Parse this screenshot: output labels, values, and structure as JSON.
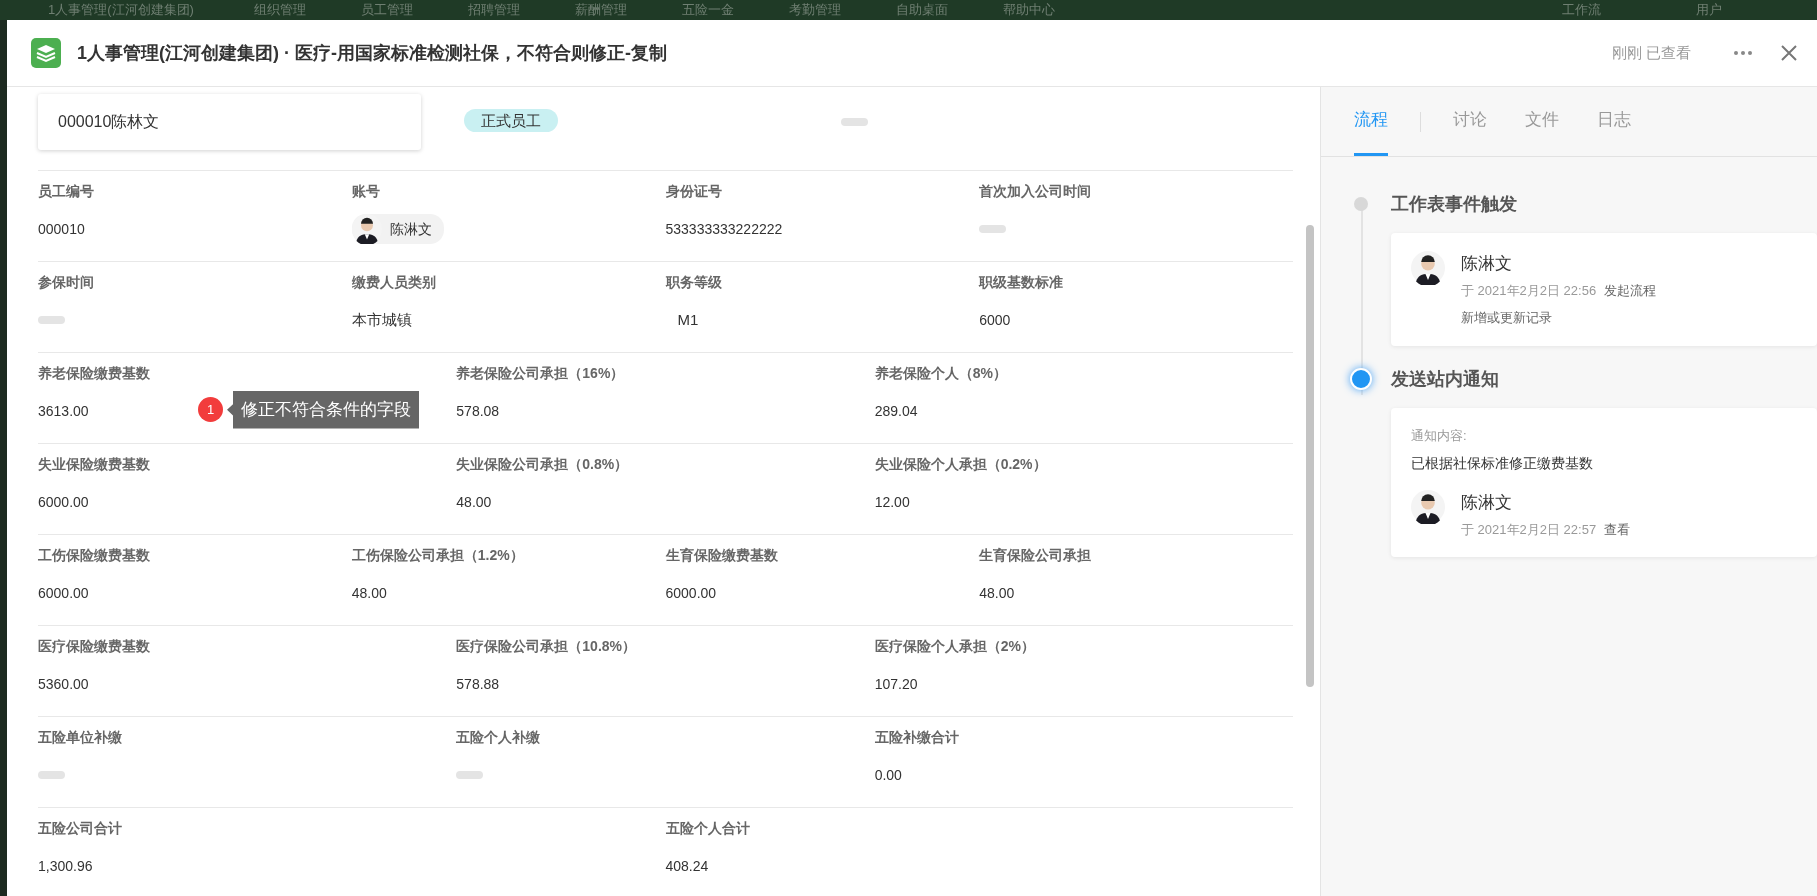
{
  "background_nav": {
    "app": "1人事管理(江河创建集团)",
    "items": [
      "组织管理",
      "员工管理",
      "招聘管理",
      "薪酬管理",
      "五险一金",
      "考勤管理",
      "自助桌面",
      "帮助中心"
    ],
    "right": [
      "工作流",
      "用户"
    ]
  },
  "header": {
    "title": "1人事管理(江河创建集团) · 医疗-用国家标准检测社保，不符合则修正-复制",
    "status": "刚刚 已查看"
  },
  "record": {
    "title": "000010陈林文",
    "items": [
      {
        "kind": "tag",
        "text": "正式员工"
      },
      {
        "kind": "empty"
      }
    ]
  },
  "rows": [
    [
      {
        "label": "员工编号",
        "kind": "text",
        "value": "000010"
      },
      {
        "label": "账号",
        "kind": "user",
        "value": "陈淋文"
      },
      {
        "label": "身份证号",
        "kind": "text",
        "value": "533333333222222"
      },
      {
        "label": "首次加入公司时间",
        "kind": "empty"
      }
    ],
    [
      {
        "label": "参保时间",
        "kind": "empty"
      },
      {
        "label": "缴费人员类别",
        "kind": "option",
        "value": "本市城镇"
      },
      {
        "label": "职务等级",
        "kind": "option",
        "value": "M1"
      },
      {
        "label": "职级基数标准",
        "kind": "text",
        "value": "6000"
      }
    ],
    [
      {
        "label": "养老保险缴费基数",
        "kind": "text",
        "value": "3613.00",
        "annotation": {
          "badge": "1",
          "text": "修正不符合条件的字段"
        }
      },
      {
        "label": "养老保险公司承担（16%）",
        "kind": "text",
        "value": "578.08"
      },
      {
        "label": "养老保险个人（8%）",
        "kind": "text",
        "value": "289.04"
      }
    ],
    [
      {
        "label": "失业保险缴费基数",
        "kind": "text",
        "value": "6000.00"
      },
      {
        "label": "失业保险公司承担（0.8%）",
        "kind": "text",
        "value": "48.00"
      },
      {
        "label": "失业保险个人承担（0.2%）",
        "kind": "text",
        "value": "12.00"
      }
    ],
    [
      {
        "label": "工伤保险缴费基数",
        "kind": "text",
        "value": "6000.00"
      },
      {
        "label": "工伤保险公司承担（1.2%）",
        "kind": "text",
        "value": "48.00"
      },
      {
        "label": "生育保险缴费基数",
        "kind": "text",
        "value": "6000.00"
      },
      {
        "label": "生育保险公司承担",
        "kind": "text",
        "value": "48.00"
      }
    ],
    [
      {
        "label": "医疗保险缴费基数",
        "kind": "text",
        "value": "5360.00"
      },
      {
        "label": "医疗保险公司承担（10.8%）",
        "kind": "text",
        "value": "578.88"
      },
      {
        "label": "医疗保险个人承担（2%）",
        "kind": "text",
        "value": "107.20"
      }
    ],
    [
      {
        "label": "五险单位补缴",
        "kind": "empty"
      },
      {
        "label": "五险个人补缴",
        "kind": "empty"
      },
      {
        "label": "五险补缴合计",
        "kind": "text",
        "value": "0.00"
      }
    ],
    [
      {
        "label": "五险公司合计",
        "kind": "text",
        "value": "1,300.96"
      },
      {
        "label": "五险个人合计",
        "kind": "text",
        "value": "408.24"
      }
    ]
  ],
  "side_tabs": [
    {
      "label": "流程",
      "selected": true
    },
    {
      "label": "讨论",
      "selected": false
    },
    {
      "label": "文件",
      "selected": false
    },
    {
      "label": "日志",
      "selected": false
    }
  ],
  "timeline": [
    {
      "title": "工作表事件触发",
      "active": false,
      "card": {
        "name": "陈淋文",
        "time": "于 2021年2月2日 22:56",
        "action": "发起流程",
        "note": "新增或更新记录"
      }
    },
    {
      "title": "发送站内通知",
      "active": true,
      "card": {
        "caption": "通知内容:",
        "message": "已根据社保标准修正缴费基数",
        "name": "陈淋文",
        "time": "于 2021年2月2日 22:57",
        "action": "查看"
      }
    }
  ]
}
